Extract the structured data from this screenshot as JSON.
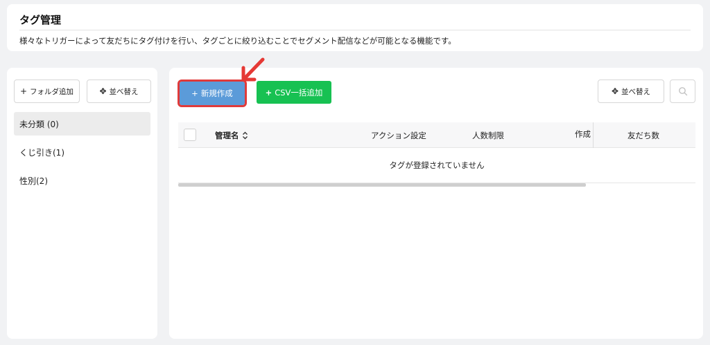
{
  "header": {
    "title": "タグ管理",
    "description": "様々なトリガーによって友だちにタグ付けを行い、タグごとに絞り込むことでセグメント配信などが可能となる機能です。"
  },
  "sidebar": {
    "folder_add_label": "フォルダ追加",
    "sort_label": "並べ替え",
    "folders": [
      {
        "label": "未分類 (0)",
        "selected": true
      },
      {
        "label": "くじ引き(1)",
        "selected": false
      },
      {
        "label": "性別(2)",
        "selected": false
      }
    ]
  },
  "toolbar": {
    "new_label": "新規作成",
    "csv_label": "CSV一括追加",
    "sort_label": "並べ替え"
  },
  "table": {
    "columns": [
      "管理名",
      "アクション設定",
      "人数制限",
      "作成",
      "友だち数"
    ],
    "empty_message": "タグが登録されていません"
  },
  "icons": {
    "plus": "plus-icon",
    "move": "move-arrows-icon",
    "search": "search-icon",
    "sort": "sort-chevrons-icon",
    "annotation": "red-arrow-annotation"
  },
  "colors": {
    "primary": "#5b9bd9",
    "green": "#17c152",
    "highlight": "#e03a3a"
  }
}
